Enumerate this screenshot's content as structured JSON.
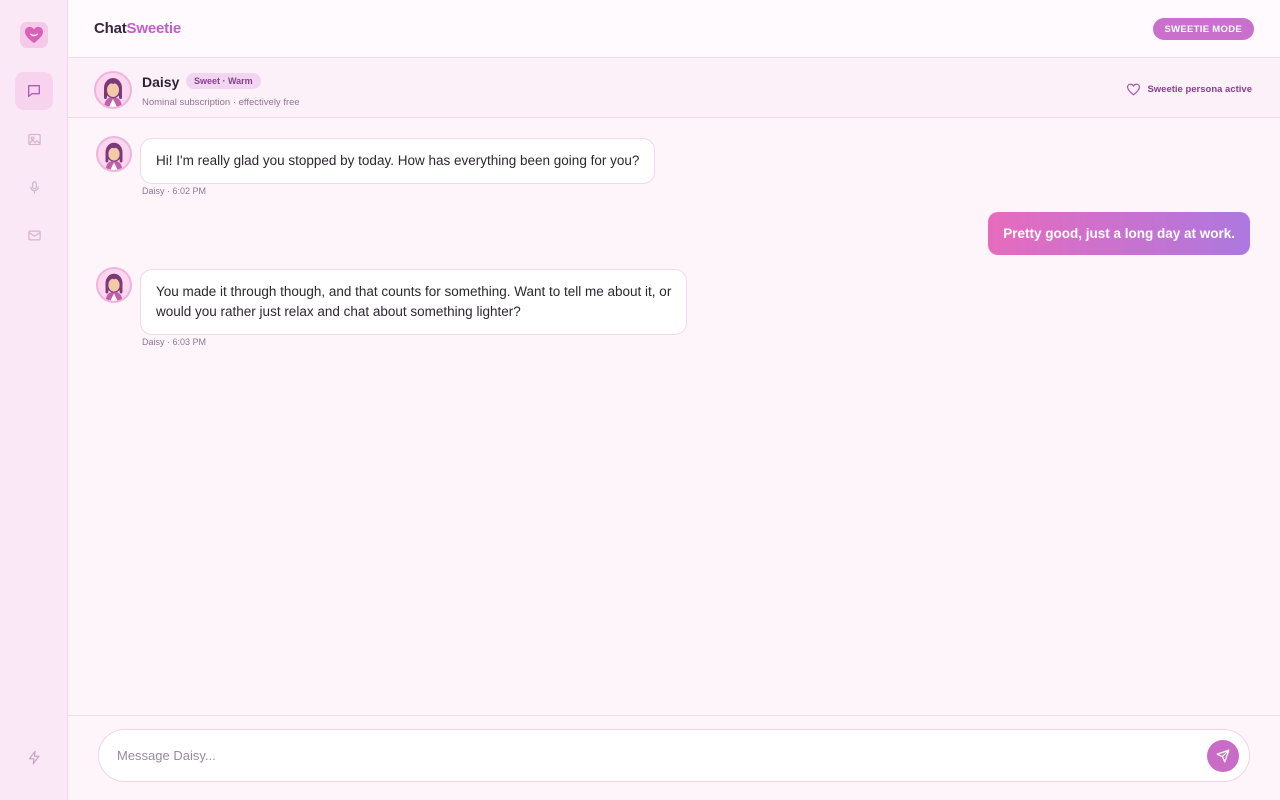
{
  "app": {
    "brand_part1": "Chat",
    "brand_part2": "Sweetie",
    "mode_button": "SWEETIE MODE"
  },
  "sidebar": {
    "items": [
      {
        "icon": "chat-icon",
        "active": true
      },
      {
        "icon": "image-icon",
        "active": false
      },
      {
        "icon": "microphone-icon",
        "active": false
      },
      {
        "icon": "mail-icon",
        "active": false
      },
      {
        "icon": "lightning-icon",
        "active": false
      }
    ]
  },
  "contact": {
    "name": "Daisy",
    "tag": "Sweet · Warm",
    "subtitle": "Nominal subscription · effectively free",
    "persona_status": "Sweetie persona active"
  },
  "messages": [
    {
      "from": "Daisy",
      "direction": "incoming",
      "lines": [
        "Hi! I'm really glad you stopped by today. How has everything been going for you?"
      ],
      "meta": "Daisy · 6:02 PM"
    },
    {
      "from": "user",
      "direction": "outgoing",
      "lines": [
        "Pretty good, just a long day at work."
      ]
    },
    {
      "from": "Daisy",
      "direction": "incoming",
      "lines": [
        "You made it through though, and that counts for something. Want to tell me about it, or",
        "would you rather just relax and chat about something lighter?"
      ],
      "meta": "Daisy · 6:03 PM"
    }
  ],
  "composer": {
    "placeholder": "Message Daisy..."
  },
  "colors": {
    "accent": "#c870cc",
    "accent_text": "#8a3d92",
    "gradient_start": "#e76bbd",
    "gradient_end": "#ad78df",
    "background": "#fef5fb"
  }
}
